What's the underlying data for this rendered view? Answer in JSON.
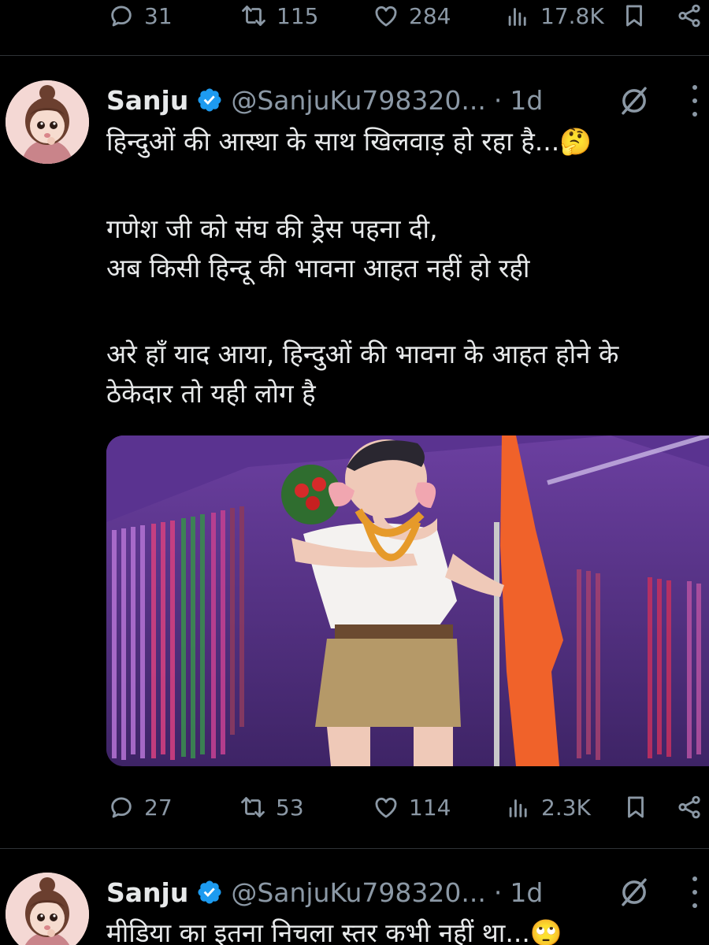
{
  "prev_tweet_actions": {
    "replies": "31",
    "reposts": "115",
    "likes": "284",
    "views": "17.8K"
  },
  "tweet1": {
    "name": "Sanju",
    "handle": "@SanjuKu798320...",
    "separator": "·",
    "time": "1d",
    "lines": [
      "हिन्दुओं की आस्था के साथ खिलवाड़ हो रहा है...🤔",
      "गणेश जी को संघ की ड्रेस पहना दी,",
      "अब किसी हिन्दू की भावना आहत नहीं हो रही",
      "अरे हाँ याद आया, हिन्दुओं की भावना के आहत होने के",
      "ठेकेदार तो यही लोग है"
    ],
    "actions": {
      "replies": "27",
      "reposts": "53",
      "likes": "114",
      "views": "2.3K"
    }
  },
  "tweet2": {
    "name": "Sanju",
    "handle": "@SanjuKu798320...",
    "separator": "·",
    "time": "1d",
    "lines": [
      "मीडिया का इतना निचला स्तर कभी नहीं था...🙄"
    ]
  },
  "icons": {
    "reply": "reply-icon",
    "repost": "repost-icon",
    "like": "like-icon",
    "views": "views-icon",
    "bookmark": "bookmark-icon",
    "share": "share-icon",
    "verified": "verified-badge-icon",
    "grok": "grok-icon",
    "more": "more-icon"
  },
  "colors": {
    "background": "#000000",
    "text": "#e7e9ea",
    "muted": "#8b98a5",
    "verified": "#1d9bf0",
    "divider": "#2f3336"
  }
}
